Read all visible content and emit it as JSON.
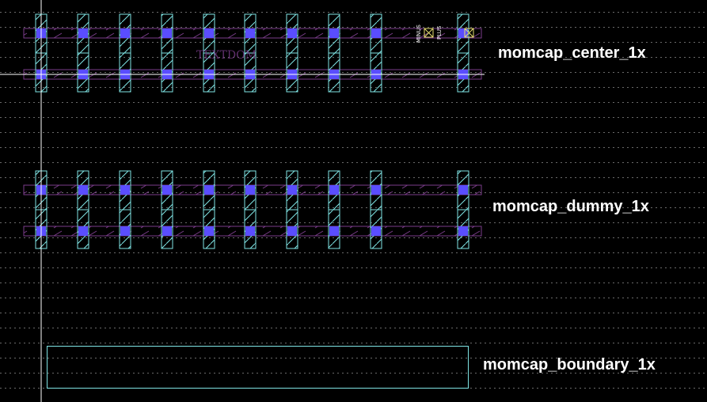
{
  "cells": [
    {
      "id": "center",
      "name": "momcap_center_1x"
    },
    {
      "id": "dummy",
      "name": "momcap_dummy_1x"
    },
    {
      "id": "boundary",
      "name": "momcap_boundary_1x"
    }
  ],
  "pin_labels": [
    "MINUS",
    "PLUS"
  ],
  "watermark": "TEXTDOM",
  "colors": {
    "background": "#000000",
    "grid": "#6a6a6a",
    "crosshair": "#ffffff",
    "metal_outline": "#7fe5e5",
    "poly_band": "#7a3c8a",
    "via": "#5a4dff",
    "pin_box": "#e8e070",
    "label": "#ffffff"
  }
}
